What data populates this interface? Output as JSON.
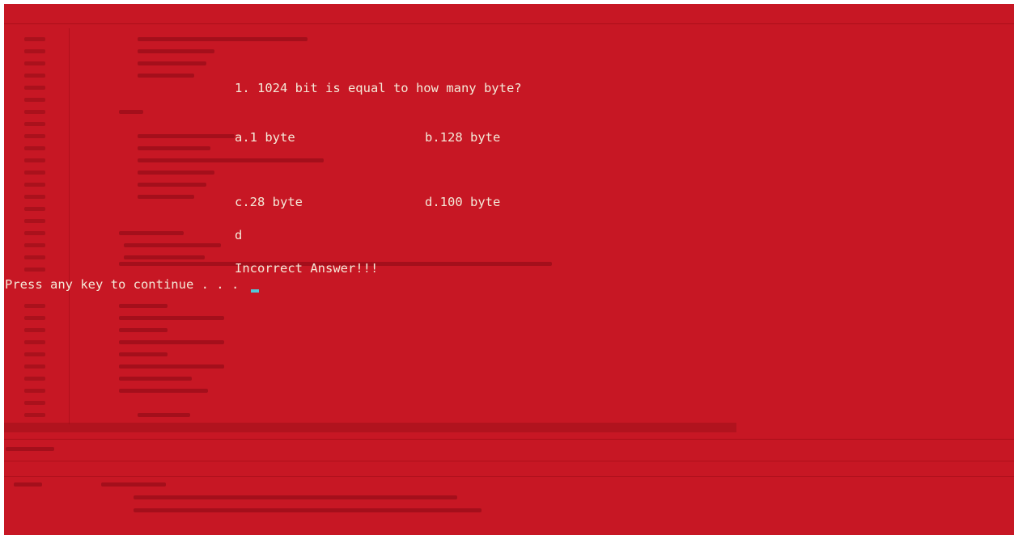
{
  "console": {
    "question": "1. 1024 bit is equal to how many byte?",
    "options": {
      "a": "a.1 byte",
      "b": "b.128 byte",
      "c": "c.28 byte",
      "d": "d.100 byte"
    },
    "user_input": "d",
    "result": "Incorrect Answer!!!",
    "prompt": "Press any key to continue . . ."
  },
  "colors": {
    "background": "#c71724",
    "text": "#f4e9d8",
    "cursor": "#52c8d8"
  }
}
